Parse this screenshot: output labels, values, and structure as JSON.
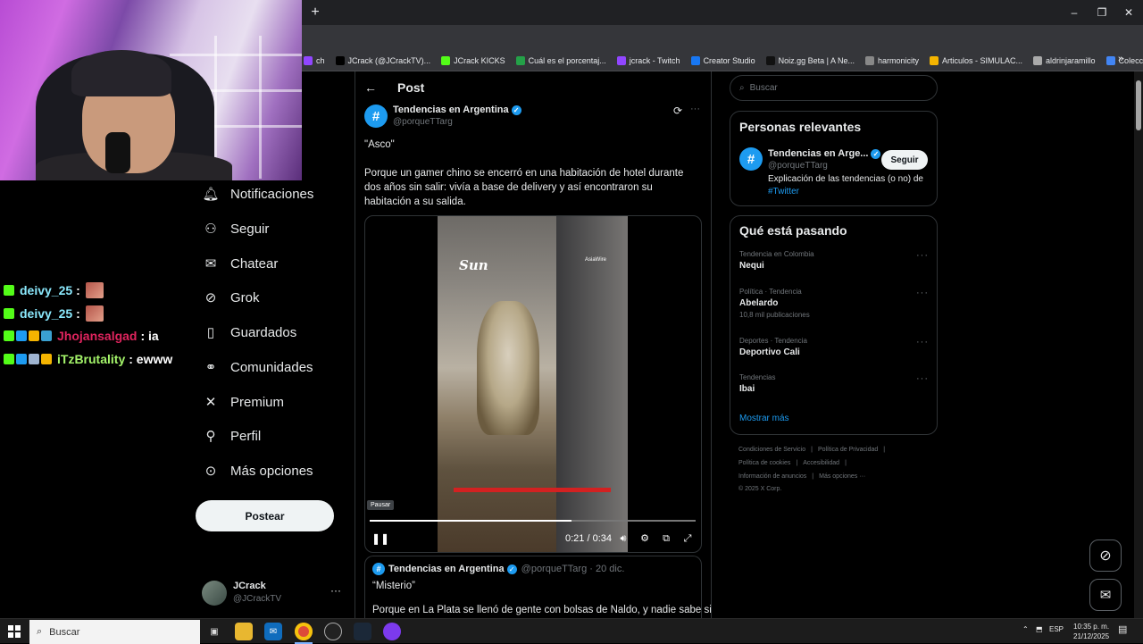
{
  "browser": {
    "new_tab": "+",
    "window_controls": {
      "minimize": "–",
      "restore": "❐",
      "close": "✕"
    },
    "bookmarks": [
      {
        "label": "ch",
        "color": "#9146ff"
      },
      {
        "label": "JCrack (@JCrackTV)...",
        "color": "#000000"
      },
      {
        "label": "JCrack KICKS",
        "color": "#53fc18"
      },
      {
        "label": "Cuál es el porcentaj...",
        "color": "#24a148"
      },
      {
        "label": "jcrack - Twitch",
        "color": "#9146ff"
      },
      {
        "label": "Creator Studio",
        "color": "#1877f2"
      },
      {
        "label": "Noiz.gg Beta | A Ne...",
        "color": "#111111"
      },
      {
        "label": "harmonicity",
        "color": "#888888"
      },
      {
        "label": "Articulos - SIMULAC...",
        "color": "#f4b400"
      },
      {
        "label": "aldrinjaramillo",
        "color": "#aaaaaa"
      },
      {
        "label": "Colección de M_blei...",
        "color": "#4285f4"
      }
    ],
    "more_bookmarks": "»"
  },
  "chat": [
    {
      "user": "deivy_25",
      "message": ":",
      "user_color": "#8be9fd",
      "has_emote": true,
      "badges": [
        "#53fc18"
      ]
    },
    {
      "user": "deivy_25",
      "message": ":",
      "user_color": "#8be9fd",
      "has_emote": true,
      "badges": [
        "#53fc18"
      ]
    },
    {
      "user": "Jhojansalgad",
      "message": ": ia",
      "user_color": "#e0245e",
      "has_emote": false,
      "badges": [
        "#53fc18",
        "#1d9bf0",
        "#f4b400",
        "#3aa0d0"
      ]
    },
    {
      "user": "iTzBrutality",
      "message": ": ewww",
      "user_color": "#a4f46a",
      "has_emote": false,
      "badges": [
        "#53fc18",
        "#1d9bf0",
        "#9fb4d0",
        "#f4b400"
      ]
    }
  ],
  "nav": {
    "items": [
      {
        "label": "Notificaciones",
        "icon": "bell-icon"
      },
      {
        "label": "Seguir",
        "icon": "add-user-icon"
      },
      {
        "label": "Chatear",
        "icon": "envelope-icon"
      },
      {
        "label": "Grok",
        "icon": "grok-icon"
      },
      {
        "label": "Guardados",
        "icon": "bookmark-icon"
      },
      {
        "label": "Comunidades",
        "icon": "communities-icon"
      },
      {
        "label": "Premium",
        "icon": "x-logo-icon"
      },
      {
        "label": "Perfil",
        "icon": "person-icon"
      },
      {
        "label": "Más opciones",
        "icon": "more-circle-icon"
      }
    ],
    "post_button": "Postear",
    "user": {
      "name": "JCrack",
      "handle": "@JCrackTV",
      "more": "···"
    }
  },
  "post": {
    "header_title": "Post",
    "author_name": "Tendencias en Argentina",
    "author_handle": "@porqueTTarg",
    "quote": "\"Asco\"",
    "body": "Porque un gamer chino se encerró en una habitación de hotel durante dos años sin salir: vivía a base de delivery y así encontraron su habitación a su salida.",
    "video": {
      "watermark": "Sun",
      "agency": "AsiaWire",
      "tooltip": "Pausar",
      "time": "0:21 / 0:34",
      "progress": 0.62
    }
  },
  "next_post": {
    "author_name": "Tendencias en Argentina",
    "author_handle": "@porqueTTarg",
    "date": "· 20 dic.",
    "quote": "“Misterio”",
    "body": "Porque en La Plata se llenó de gente con bolsas de Naldo, y nadie sabe si"
  },
  "sidebar": {
    "search_placeholder": "Buscar",
    "relevant": {
      "title": "Personas relevantes",
      "name": "Tendencias en Arge...",
      "handle": "@porqueTTarg",
      "follow": "Seguir",
      "bio": "Explicación de las tendencias (o no) de",
      "bio_link": "#Twitter"
    },
    "trending": {
      "title": "Qué está pasando",
      "items": [
        {
          "meta": "Tendencia en Colombia",
          "name": "Nequi",
          "count": ""
        },
        {
          "meta": "Política · Tendencia",
          "name": "Abelardo",
          "count": "10,8 mil publicaciones"
        },
        {
          "meta": "Deportes · Tendencia",
          "name": "Deportivo Cali",
          "count": ""
        },
        {
          "meta": "Tendencias",
          "name": "Ibai",
          "count": ""
        }
      ],
      "show_more": "Mostrar más"
    },
    "footer": {
      "line1": [
        "Condiciones de Servicio",
        "|",
        "Política de Privacidad",
        "|"
      ],
      "line2": [
        "Política de cookies",
        "|",
        "Accesibilidad",
        "|"
      ],
      "line3": [
        "Información de anuncios",
        "|",
        "Más opciones ···"
      ],
      "copyright": "© 2025 X Corp."
    }
  },
  "taskbar": {
    "search": "Buscar",
    "lang": "ESP",
    "time": "10:35 p. m.",
    "date": "21/12/2025"
  }
}
